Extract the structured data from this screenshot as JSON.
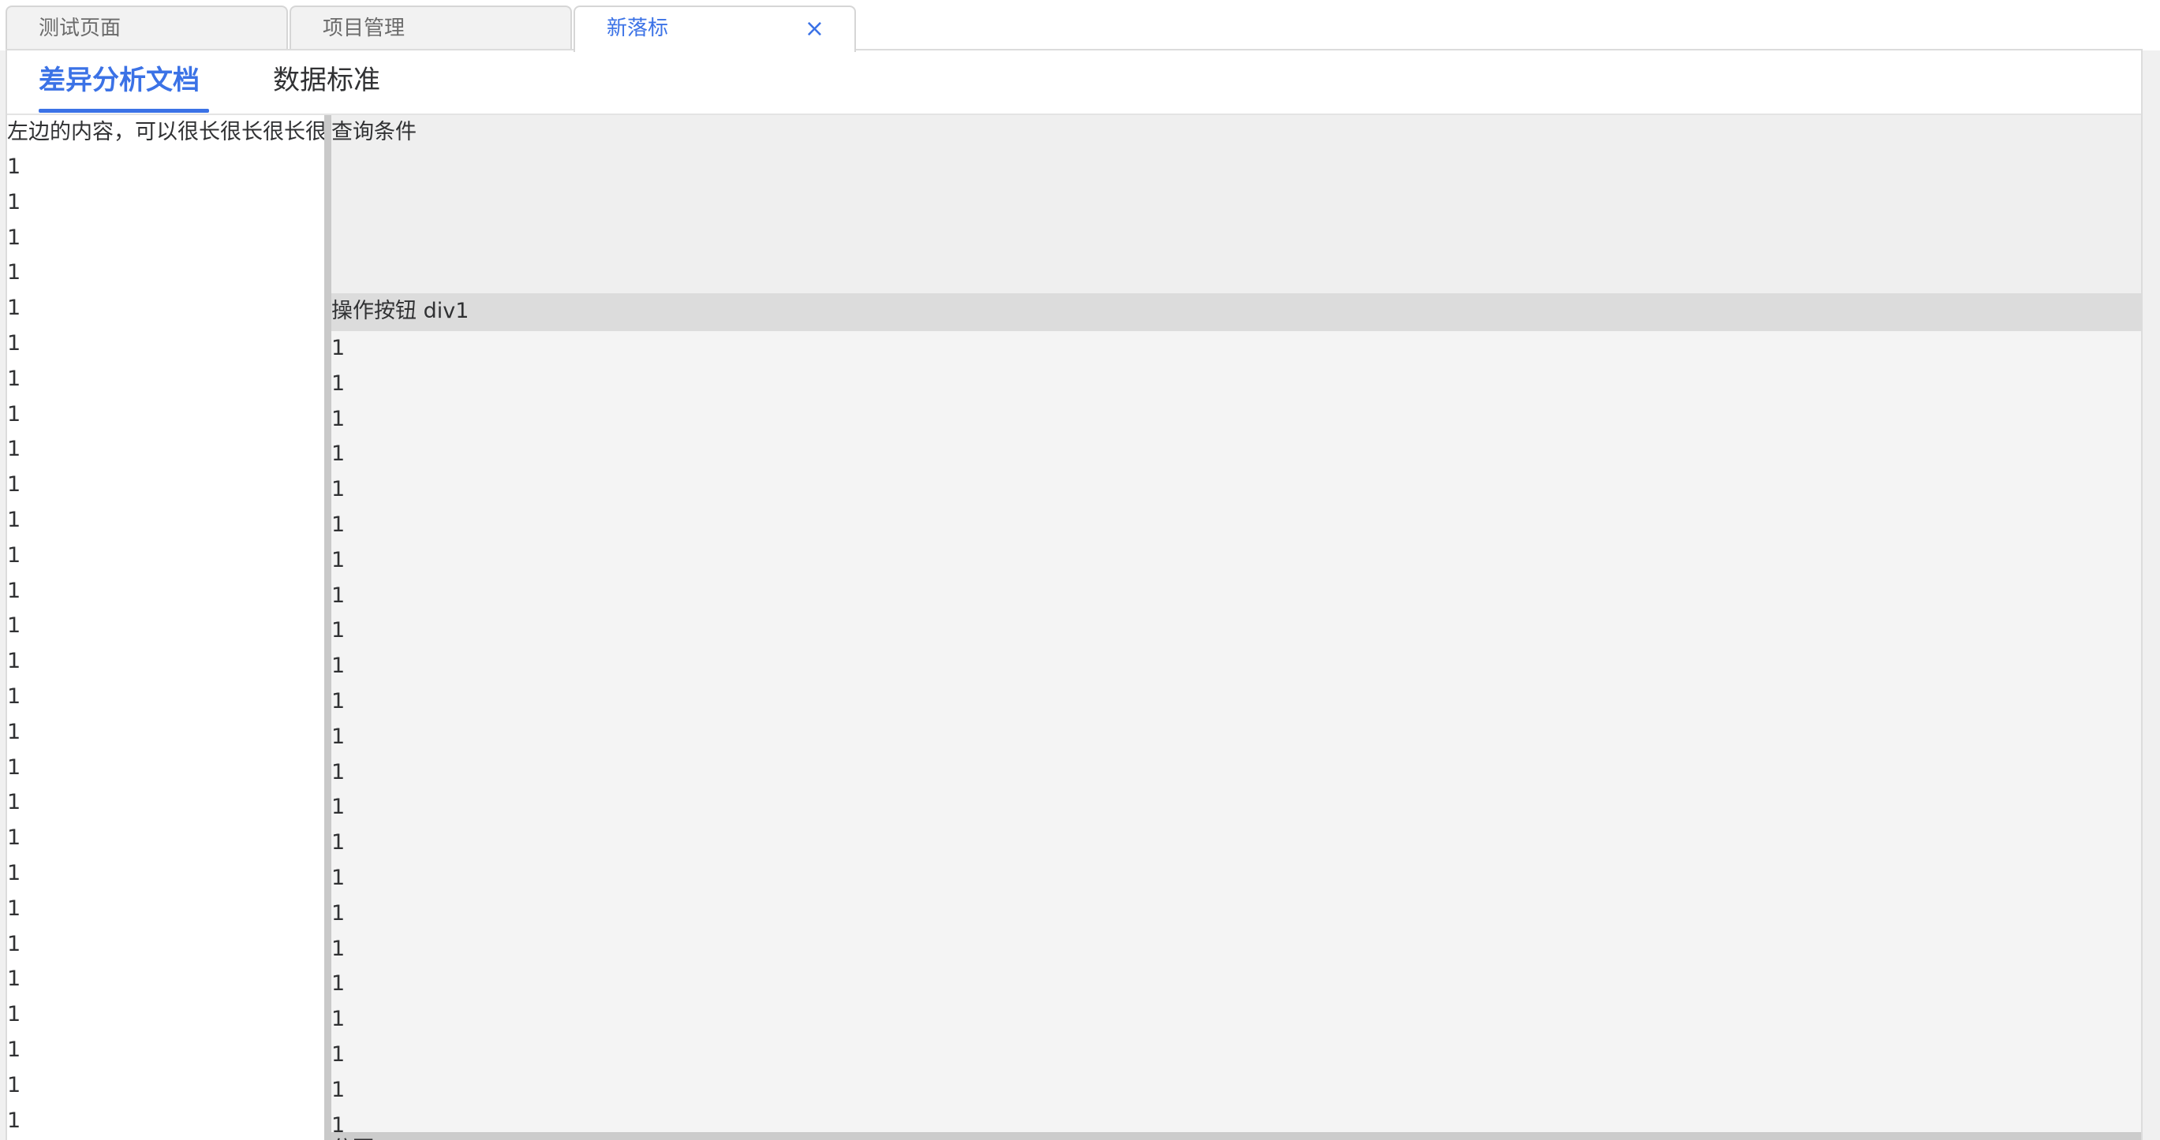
{
  "tabs": [
    {
      "label": "测试页面",
      "active": false
    },
    {
      "label": "项目管理",
      "active": false
    },
    {
      "label": "新落标",
      "active": true,
      "closable": true
    }
  ],
  "close_icon": "close-icon",
  "subtabs": [
    {
      "label": "差异分析文档",
      "active": true
    },
    {
      "label": "数据标准",
      "active": false
    }
  ],
  "left_panel": {
    "header": "左边的内容，可以很长很长很长很长很长很长很长很长很长",
    "lines": [
      "1",
      "1",
      "1",
      "1",
      "1",
      "1",
      "1",
      "1",
      "1",
      "1",
      "1",
      "1",
      "1",
      "1",
      "1",
      "1",
      "1",
      "1",
      "1",
      "1",
      "1",
      "1",
      "1",
      "1",
      "1",
      "1",
      "1",
      "1"
    ]
  },
  "right_panel": {
    "query_label": "查询条件",
    "actions_label": "操作按钮 div1",
    "lines": [
      "1",
      "1",
      "1",
      "1",
      "1",
      "1",
      "1",
      "1",
      "1",
      "1",
      "1",
      "1",
      "1",
      "1",
      "1",
      "1",
      "1",
      "1",
      "1",
      "1",
      "1",
      "1",
      "1"
    ],
    "pagination_label": "分页"
  },
  "colors": {
    "accent": "#3b72e6"
  }
}
